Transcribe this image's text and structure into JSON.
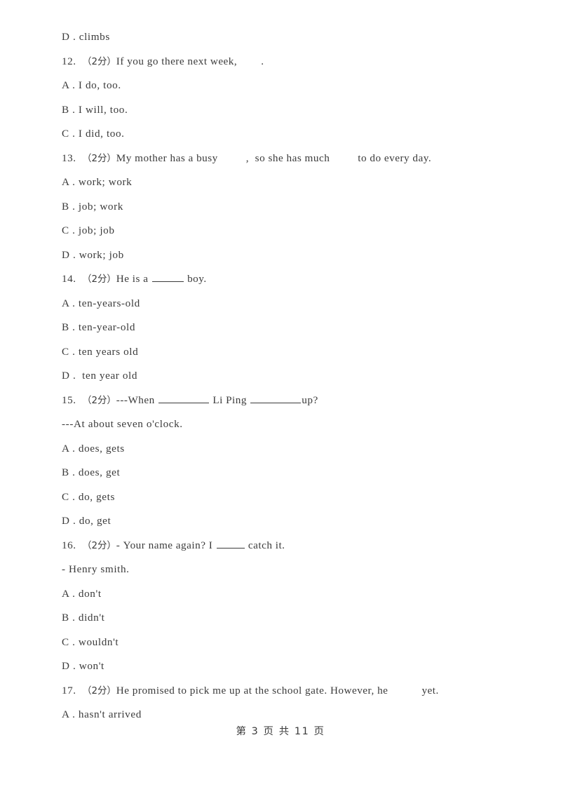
{
  "document": {
    "page_footer": "第 3 页 共 11 页",
    "marks_label": "（2分）",
    "text_color": "#3b3b3b",
    "background_color": "#ffffff"
  },
  "lines": [
    {
      "kind": "option",
      "letter": "D",
      "sep": " . ",
      "text": "climbs",
      "full": "D . climbs"
    },
    {
      "kind": "question",
      "number": "12.",
      "marks": "（2分）",
      "stem_before": "If you go there next week,",
      "stem_after": ".",
      "full": "12.  （2分）If you go there next week,        ."
    },
    {
      "kind": "option",
      "letter": "A",
      "sep": " . ",
      "text": "I do, too.",
      "full": "A . I do, too."
    },
    {
      "kind": "option",
      "letter": "B",
      "sep": " . ",
      "text": "I will, too.",
      "full": "B . I will, too."
    },
    {
      "kind": "option",
      "letter": "C",
      "sep": " . ",
      "text": "I did, too.",
      "full": "C . I did, too."
    },
    {
      "kind": "question",
      "number": "13.",
      "marks": "（2分）",
      "stem_before": "My mother has a busy",
      "stem_mid": ",  so she has much",
      "stem_after": "to do every day.",
      "full": "13.  （2分）My mother has a busy      ,  so she has much      to do every day."
    },
    {
      "kind": "option",
      "letter": "A",
      "sep": " . ",
      "text": "work; work",
      "full": "A . work; work"
    },
    {
      "kind": "option",
      "letter": "B",
      "sep": " . ",
      "text": "job; work",
      "full": "B . job; work"
    },
    {
      "kind": "option",
      "letter": "C",
      "sep": " . ",
      "text": "job; job",
      "full": "C . job; job"
    },
    {
      "kind": "option",
      "letter": "D",
      "sep": " . ",
      "text": "work; job",
      "full": "D . work; job"
    },
    {
      "kind": "question",
      "number": "14.",
      "marks": "（2分）",
      "stem_before": "He is a",
      "stem_after": "boy.",
      "full": "14.  （2分）He is a ______ boy."
    },
    {
      "kind": "option",
      "letter": "A",
      "sep": " . ",
      "text": "ten-years-old",
      "full": "A . ten-years-old"
    },
    {
      "kind": "option",
      "letter": "B",
      "sep": " . ",
      "text": "ten-year-old",
      "full": "B . ten-year-old"
    },
    {
      "kind": "option",
      "letter": "C",
      "sep": " . ",
      "text": "ten years old",
      "full": "C . ten years old"
    },
    {
      "kind": "option",
      "letter": "D",
      "sep": " .  ",
      "text": "ten year old",
      "full": "D .  ten year old"
    },
    {
      "kind": "question",
      "number": "15.",
      "marks": "（2分）",
      "stem_before": "---When",
      "stem_mid": "Li Ping",
      "stem_after": "up?",
      "full": "15.  （2分）---When _________ Li Ping _________up?"
    },
    {
      "kind": "plain",
      "text": "---At about seven o'clock.",
      "full": "---At about seven o'clock."
    },
    {
      "kind": "option",
      "letter": "A",
      "sep": " . ",
      "text": "does, gets",
      "full": "A . does, gets"
    },
    {
      "kind": "option",
      "letter": "B",
      "sep": " . ",
      "text": "does, get",
      "full": "B . does, get"
    },
    {
      "kind": "option",
      "letter": "C",
      "sep": " . ",
      "text": "do, gets",
      "full": "C . do, gets"
    },
    {
      "kind": "option",
      "letter": "D",
      "sep": " . ",
      "text": "do, get",
      "full": "D . do, get"
    },
    {
      "kind": "question",
      "number": "16.",
      "marks": "（2分）",
      "stem_before": "- Your name again? I",
      "stem_after": "catch it.",
      "full": "16.  （2分）- Your name again? I _____ catch it."
    },
    {
      "kind": "plain",
      "text": "- Henry smith.",
      "full": "- Henry smith."
    },
    {
      "kind": "option",
      "letter": "A",
      "sep": " . ",
      "text": "don't",
      "full": "A . don't"
    },
    {
      "kind": "option",
      "letter": "B",
      "sep": " . ",
      "text": "didn't",
      "full": "B . didn't"
    },
    {
      "kind": "option",
      "letter": "C",
      "sep": " . ",
      "text": "wouldn't",
      "full": "C . wouldn't"
    },
    {
      "kind": "option",
      "letter": "D",
      "sep": " . ",
      "text": "won't",
      "full": "D . won't"
    },
    {
      "kind": "question",
      "number": "17.",
      "marks": "（2分）",
      "stem_before": "He promised to pick me up at the school gate. However, he",
      "stem_after": "yet.",
      "full": "17.  （2分）He promised to pick me up at the school gate. However, he      yet."
    },
    {
      "kind": "option",
      "letter": "A",
      "sep": " . ",
      "text": "hasn't arrived",
      "full": "A . hasn't arrived"
    }
  ]
}
